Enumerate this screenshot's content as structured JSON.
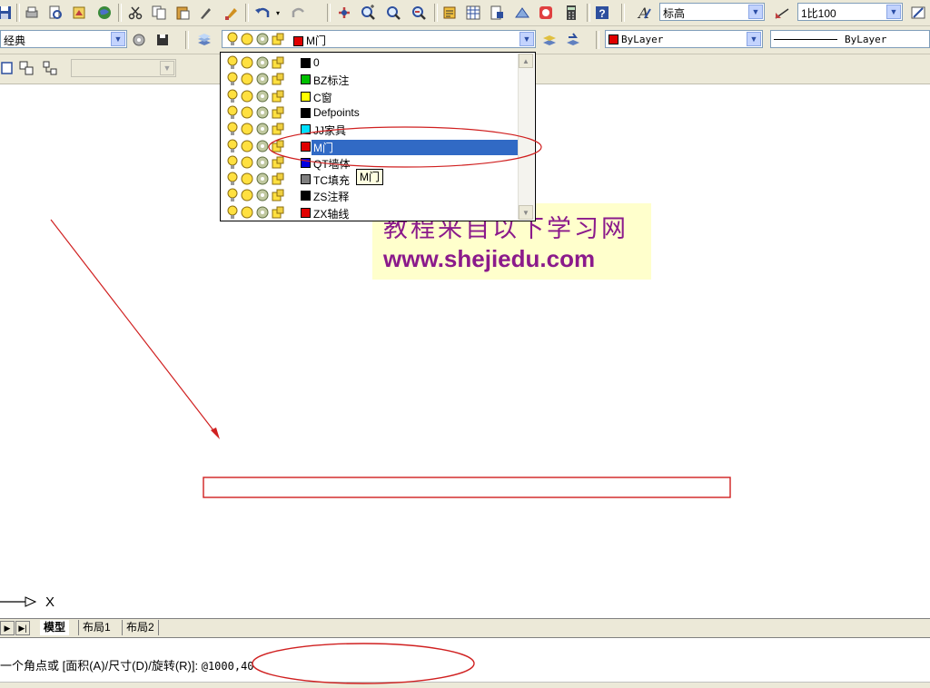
{
  "toolbar_top": {
    "text_style": "标高",
    "dim_scale": "1比100"
  },
  "toolbar_props": {
    "workspace": "经典",
    "current_layer": "M门",
    "current_layer_color": "#e00000",
    "color_combo": "ByLayer",
    "color_combo_swatch": "#e00000",
    "linetype_combo": "ByLayer"
  },
  "layers": {
    "items": [
      {
        "name": "0",
        "color": "#000000"
      },
      {
        "name": "BZ标注",
        "color": "#00c000"
      },
      {
        "name": "C窗",
        "color": "#ffff00"
      },
      {
        "name": "Defpoints",
        "color": "#000000"
      },
      {
        "name": "JJ家具",
        "color": "#00e0ff"
      },
      {
        "name": "M门",
        "color": "#e00000"
      },
      {
        "name": "QT墙体",
        "color": "#0000e0"
      },
      {
        "name": "TC填充",
        "color": "#808080"
      },
      {
        "name": "ZS注释",
        "color": "#000000"
      },
      {
        "name": "ZX轴线",
        "color": "#e00000"
      }
    ],
    "selected_index": 5,
    "tooltip": "M门"
  },
  "watermark": {
    "cn": "教程来自以下学习网",
    "url": "www.shejiedu.com"
  },
  "ucs": {
    "x_label": "X"
  },
  "tabs": {
    "model": "模型",
    "layout1": "布局1",
    "layout2": "布局2"
  },
  "command": {
    "prompt": "一个角点或 [面积(A)/尺寸(D)/旋转(R)]: ",
    "input": "@1000,40"
  },
  "colors": {
    "annotation": "#d02020",
    "highlight": "#316ac5"
  }
}
